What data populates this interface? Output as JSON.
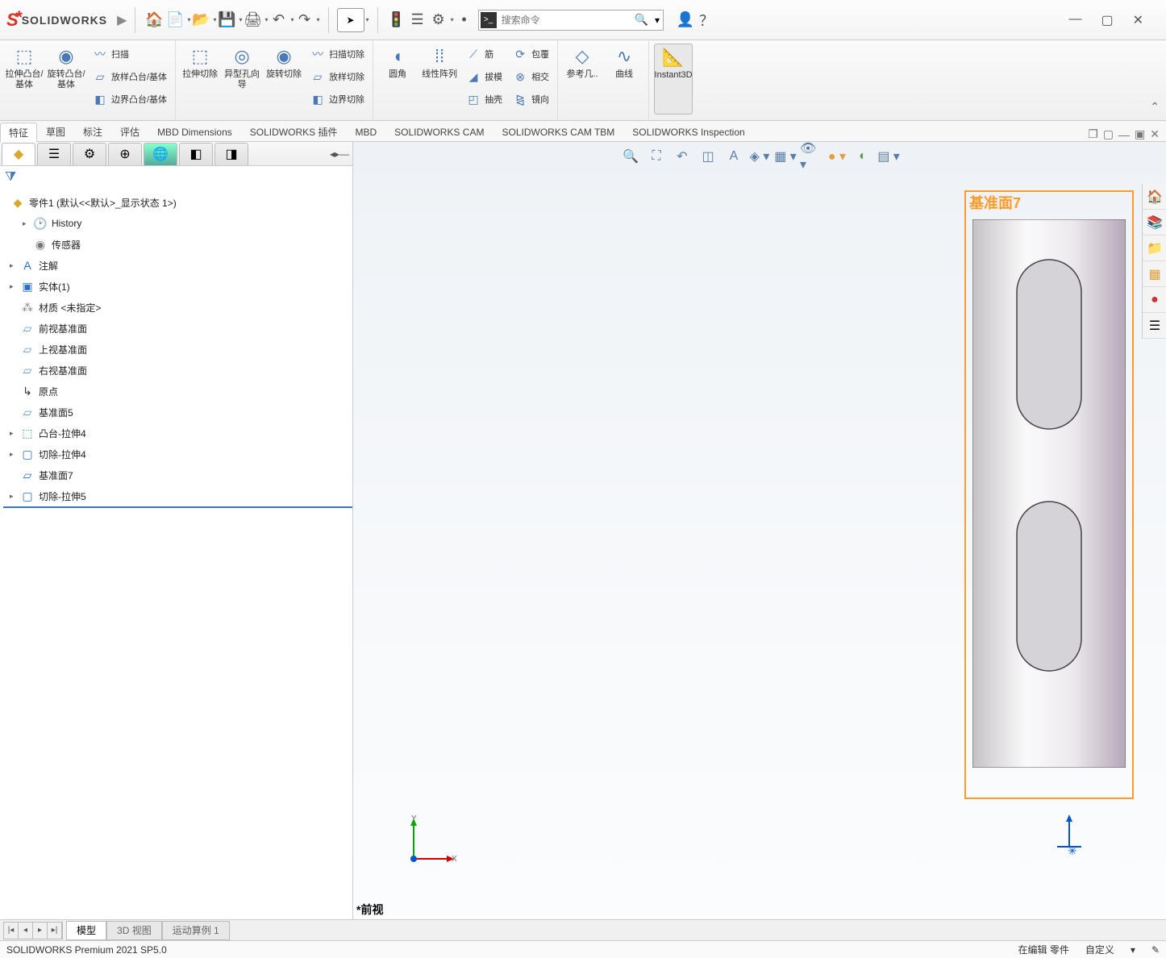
{
  "app": {
    "name": "SOLIDWORKS"
  },
  "search": {
    "placeholder": "搜索命令"
  },
  "ribbon": {
    "extrude": "拉伸凸台/基体",
    "revolve": "旋转凸台/基体",
    "sweep": "扫描",
    "loft": "放样凸台/基体",
    "boundary": "边界凸台/基体",
    "cut_ext": "拉伸切除",
    "hole": "异型孔向导",
    "cut_rev": "旋转切除",
    "cut_sweep": "扫描切除",
    "cut_loft": "放样切除",
    "cut_bnd": "边界切除",
    "fillet": "圆角",
    "lin_pat": "线性阵列",
    "rib": "筋",
    "draft": "拔模",
    "shell": "抽壳",
    "wrap": "包覆",
    "intersect": "相交",
    "mirror": "镜向",
    "refgeo": "参考几..",
    "curves": "曲线",
    "instant3d": "Instant3D"
  },
  "cmd_tabs": [
    "特征",
    "草图",
    "标注",
    "评估",
    "MBD Dimensions",
    "SOLIDWORKS 插件",
    "MBD",
    "SOLIDWORKS CAM",
    "SOLIDWORKS CAM TBM",
    "SOLIDWORKS Inspection"
  ],
  "tree": {
    "root": "零件1 (默认<<默认>_显示状态 1>)",
    "items": [
      {
        "label": "History",
        "icon": "clock",
        "lvl": 1,
        "exp": "▸"
      },
      {
        "label": "传感器",
        "icon": "sensor",
        "lvl": 1,
        "exp": ""
      },
      {
        "label": "注解",
        "icon": "A",
        "lvl": 0,
        "exp": "▸"
      },
      {
        "label": "实体(1)",
        "icon": "body",
        "lvl": 0,
        "exp": "▸"
      },
      {
        "label": "材质 <未指定>",
        "icon": "mat",
        "lvl": 0,
        "exp": ""
      },
      {
        "label": "前视基准面",
        "icon": "plane",
        "lvl": 0,
        "exp": ""
      },
      {
        "label": "上视基准面",
        "icon": "plane",
        "lvl": 0,
        "exp": ""
      },
      {
        "label": "右视基准面",
        "icon": "plane",
        "lvl": 0,
        "exp": ""
      },
      {
        "label": "原点",
        "icon": "origin",
        "lvl": 0,
        "exp": ""
      },
      {
        "label": "基准面5",
        "icon": "plane",
        "lvl": 0,
        "exp": ""
      },
      {
        "label": "凸台-拉伸4",
        "icon": "extrude",
        "lvl": 0,
        "exp": "▸"
      },
      {
        "label": "切除-拉伸4",
        "icon": "cut",
        "lvl": 0,
        "exp": "▸"
      },
      {
        "label": "基准面7",
        "icon": "plane-sel",
        "lvl": 0,
        "exp": ""
      },
      {
        "label": "切除-拉伸5",
        "icon": "cut",
        "lvl": 0,
        "exp": "▸"
      }
    ]
  },
  "viewport": {
    "plane_label": "基准面7",
    "view_name": "*前视"
  },
  "bottom_tabs": [
    "模型",
    "3D 视图",
    "运动算例 1"
  ],
  "status": {
    "left": "SOLIDWORKS Premium 2021 SP5.0",
    "mode": "在编辑 零件",
    "cust": "自定义"
  }
}
